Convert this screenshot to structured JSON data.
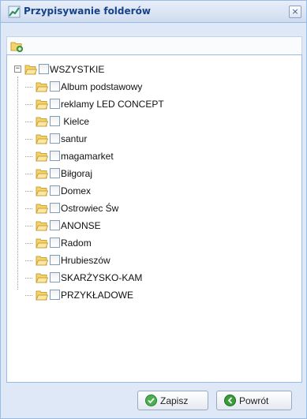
{
  "dialog": {
    "title": "Przypisywanie folderów",
    "close_label": "×"
  },
  "toolbar": {
    "add_folder_icon": "folder-add-icon"
  },
  "tree": {
    "root": {
      "label": "WSZYSTKIE",
      "expanded": true,
      "checked": false
    },
    "items": [
      {
        "label": "Album podstawowy",
        "checked": false
      },
      {
        "label": "reklamy LED CONCEPT",
        "checked": false
      },
      {
        "label": " Kielce",
        "checked": false
      },
      {
        "label": "santur",
        "checked": false
      },
      {
        "label": "magamarket",
        "checked": false
      },
      {
        "label": "Biłgoraj",
        "checked": false
      },
      {
        "label": "Domex",
        "checked": false
      },
      {
        "label": "Ostrowiec Św",
        "checked": false
      },
      {
        "label": "ANONSE",
        "checked": false
      },
      {
        "label": "Radom",
        "checked": false
      },
      {
        "label": "Hrubieszów",
        "checked": false
      },
      {
        "label": "SKARŻYSKO-KAM",
        "checked": false
      },
      {
        "label": "PRZYKŁADOWE",
        "checked": false
      }
    ]
  },
  "buttons": {
    "save_label": "Zapisz",
    "back_label": "Powrót"
  },
  "colors": {
    "title_text": "#15428b",
    "panel_border": "#99bbe8",
    "folder_yellow": "#f5d36b",
    "save_icon": "#4caf50",
    "back_icon": "#3a9d3a"
  }
}
